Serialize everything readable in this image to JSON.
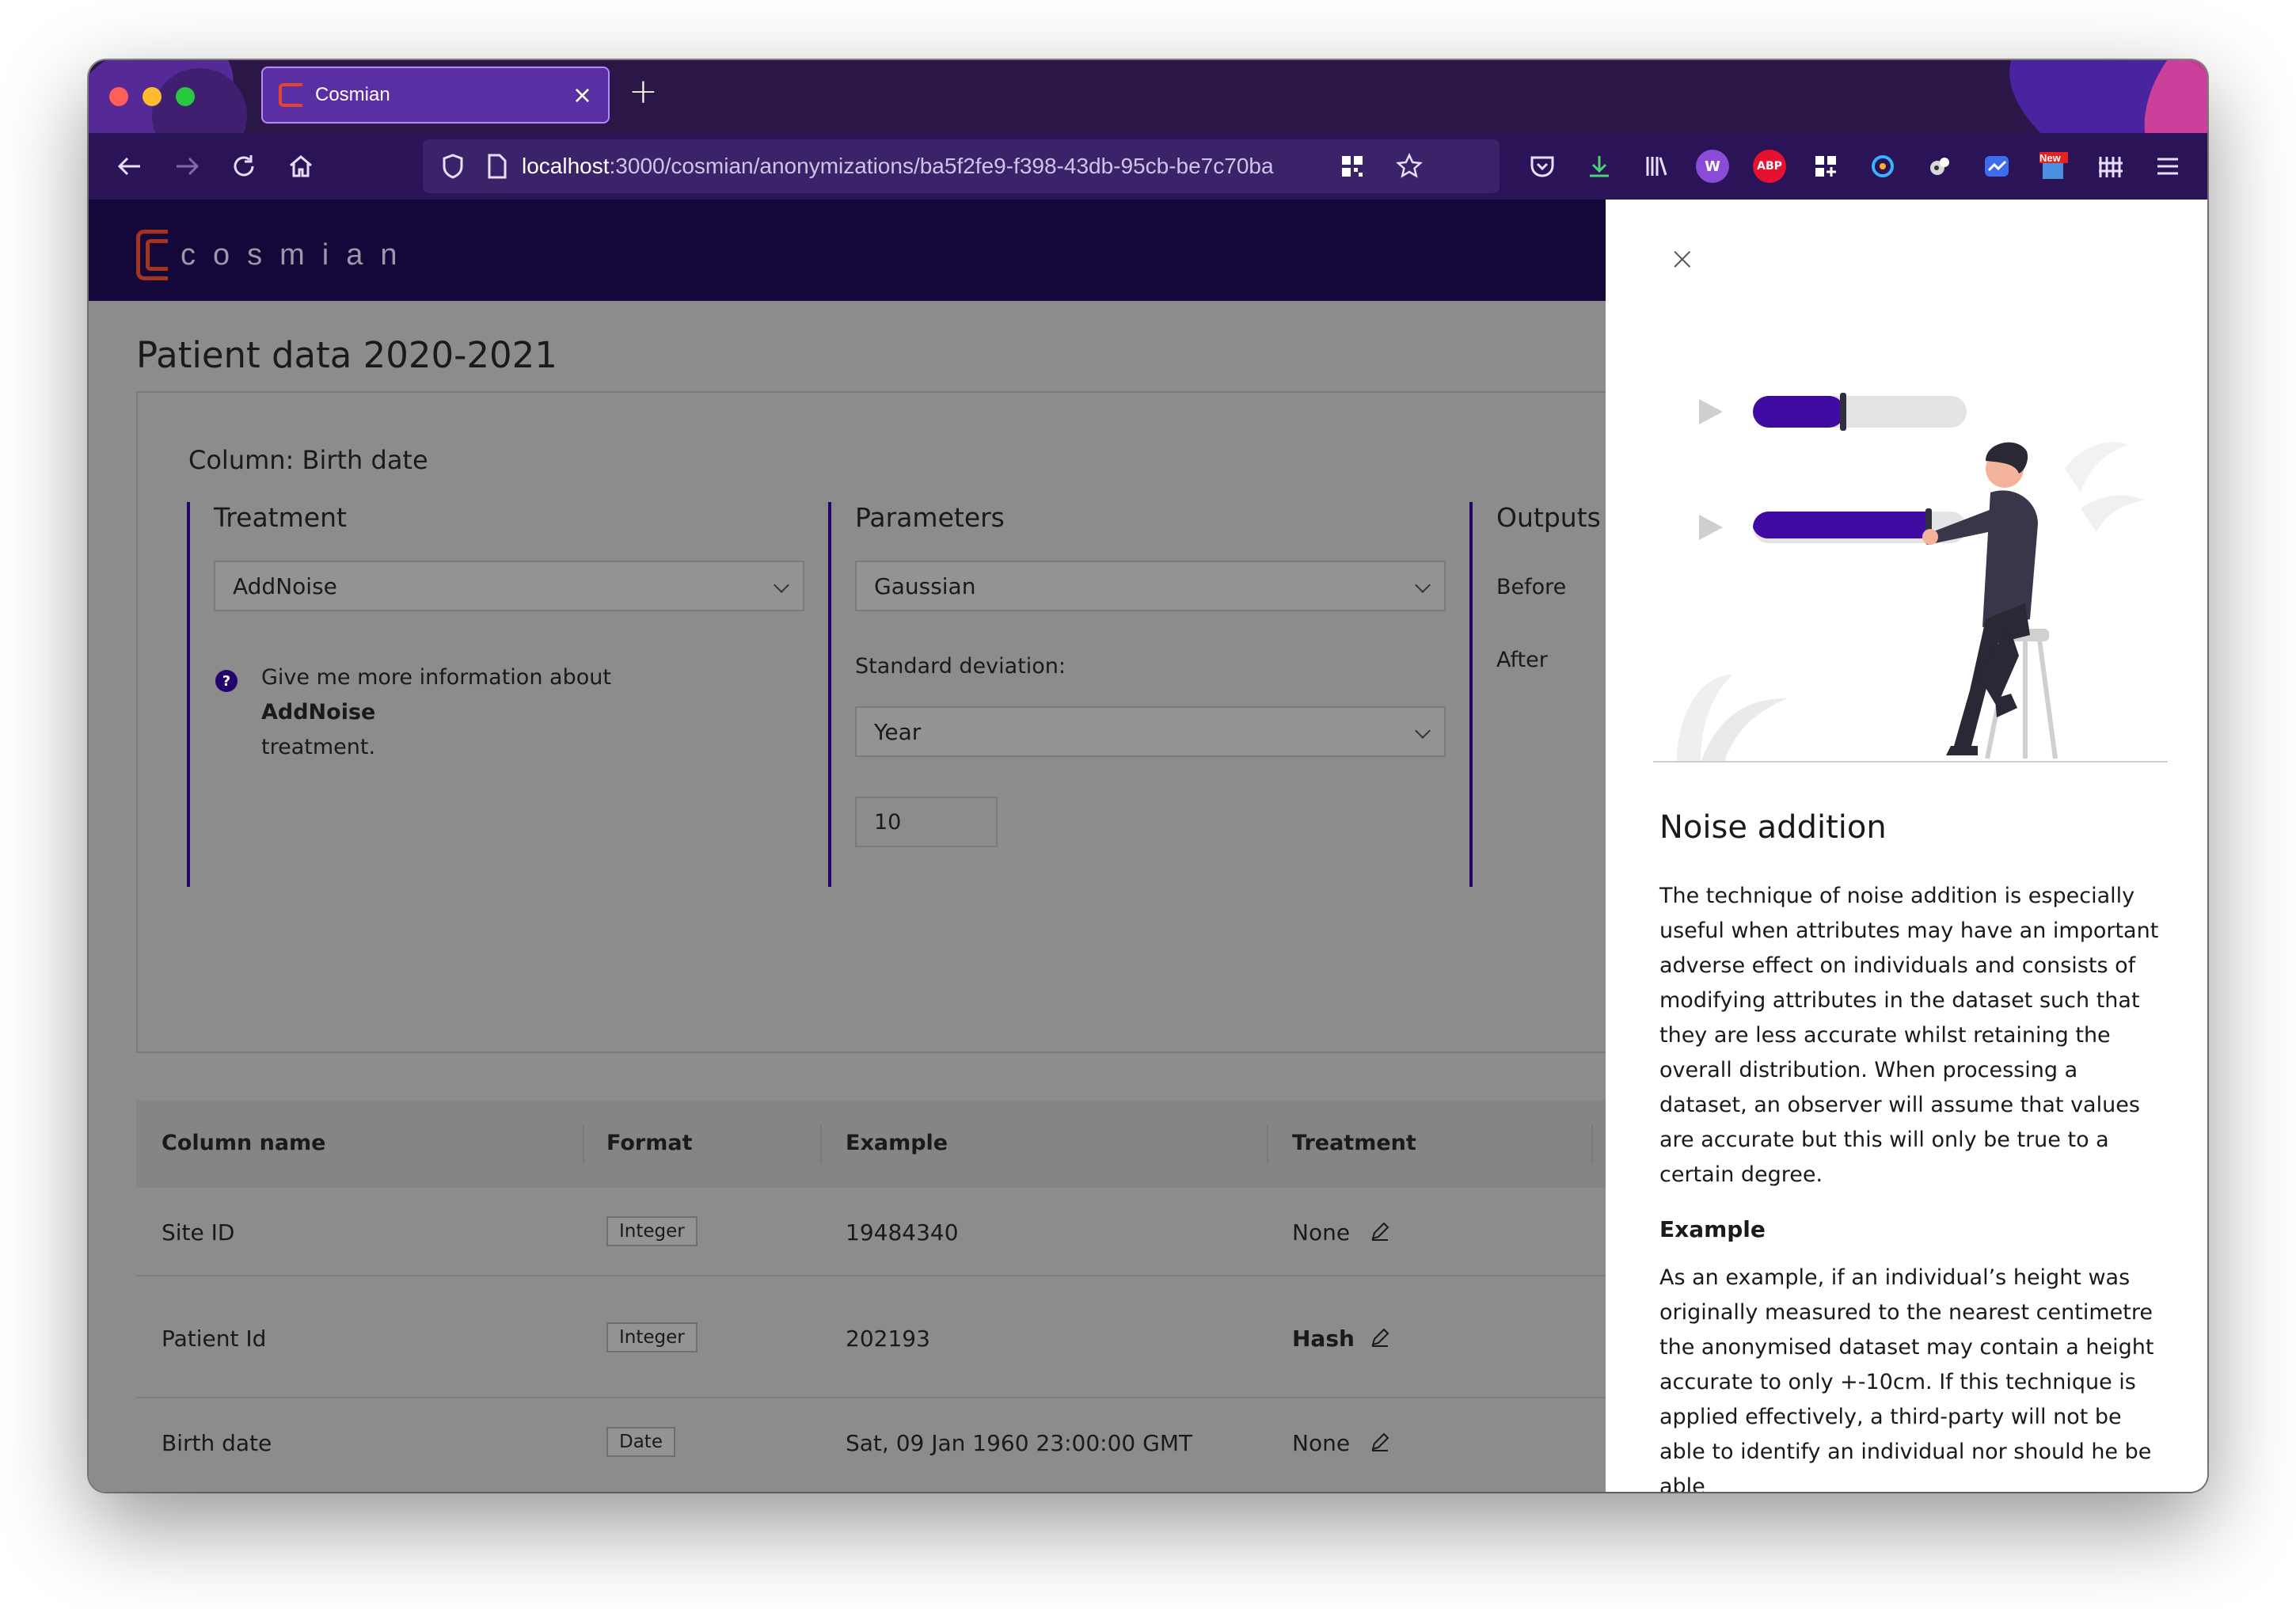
{
  "browser": {
    "tab_title": "Cosmian",
    "tab_close": "×",
    "new_tab": "+",
    "url_host": "localhost",
    "url_path": ":3000/cosmian/anonymizations/ba5f2fe9-f398-43db-95cb-be7c70ba",
    "ext_abp": "ABP",
    "ext_new": "New",
    "ext_w": "W"
  },
  "header": {
    "logo_text": "cosmian"
  },
  "page": {
    "title": "Patient data 2020-2021"
  },
  "card": {
    "column_title": "Column: Birth date",
    "treatment": {
      "heading": "Treatment",
      "selected": "AddNoise",
      "info_prefix": "Give me more information about ",
      "info_bold": "AddNoise",
      "info_suffix": " treatment."
    },
    "parameters": {
      "heading": "Parameters",
      "distribution": "Gaussian",
      "std_label": "Standard deviation:",
      "unit": "Year",
      "value": "10"
    },
    "outputs": {
      "heading": "Outputs",
      "before": "Before",
      "after": "After"
    }
  },
  "table": {
    "headers": [
      "Column name",
      "Format",
      "Example",
      "Treatment"
    ],
    "rows": [
      {
        "name": "Site ID",
        "format": "Integer",
        "example": "19484340",
        "treatment": "None",
        "bold": false
      },
      {
        "name": "Patient Id",
        "format": "Integer",
        "example": "202193",
        "treatment": "Hash",
        "bold": true
      },
      {
        "name": "Birth date",
        "format": "Date",
        "example": "Sat, 09 Jan 1960 23:00:00 GMT",
        "treatment": "None",
        "bold": false
      }
    ]
  },
  "drawer": {
    "close": "×",
    "title": "Noise addition",
    "body": "The technique of noise addition is especially useful when attributes may have an important adverse effect on individuals and consists of modifying attributes in the dataset such that they are less accurate whilst retaining the overall distribution. When processing a dataset, an observer will assume that values are accurate but this will only be true to a certain degree.",
    "example_heading": "Example",
    "example_body": "As an example, if an individual’s height was originally measured to the nearest centimetre the anonymised dataset may contain a height accurate to only +-10cm. If this technique is applied effectively, a third-party will not be able to identify an individual nor should he be able"
  },
  "colors": {
    "brand_purple": "#24036a",
    "header_bg": "#140739",
    "logo_red": "#a4341e",
    "overlay_gray": "#8c8c8c"
  }
}
